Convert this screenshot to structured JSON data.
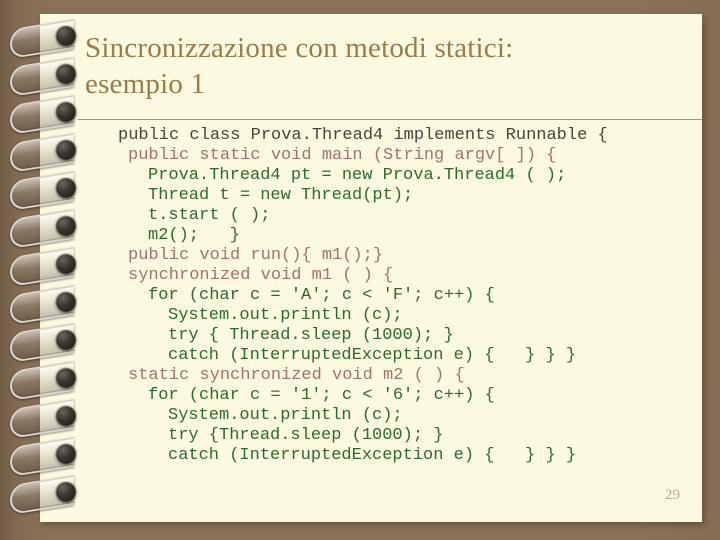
{
  "slide": {
    "title_line_1": "Sincronizzazione con metodi statici:",
    "title_line_2": "esempio 1",
    "page_number": "29",
    "colors": {
      "background": "#8a7258",
      "paper": "#fbfae1",
      "title": "#9c7b4a",
      "rule": "#a89468",
      "code_dark": "#4a453d",
      "code_rose": "#a8706a",
      "code_green": "#2d6b2d",
      "page_number": "#b8a98c"
    }
  },
  "code": {
    "language": "java",
    "lines": [
      {
        "text": "public class Prova.Thread4 implements Runnable {",
        "color": "dark",
        "indent": 0
      },
      {
        "text": "public static void main (String argv[ ]) {",
        "color": "rose",
        "indent": 1
      },
      {
        "text": "Prova.Thread4 pt = new Prova.Thread4 ( );",
        "color": "green",
        "indent": 2
      },
      {
        "text": "Thread t = new Thread(pt);",
        "color": "green",
        "indent": 2
      },
      {
        "text": "t.start ( );",
        "color": "green",
        "indent": 2
      },
      {
        "text": "m2();   }",
        "color": "green",
        "indent": 2
      },
      {
        "text": "public void run(){ m1();}",
        "color": "rose",
        "indent": 1
      },
      {
        "text": "synchronized void m1 ( ) {",
        "color": "rose",
        "indent": 1
      },
      {
        "text": "for (char c = 'A'; c < 'F'; c++) {",
        "color": "green",
        "indent": 2
      },
      {
        "text": "System.out.println (c);",
        "color": "green",
        "indent": 3
      },
      {
        "text": "try { Thread.sleep (1000); }",
        "color": "green",
        "indent": 3
      },
      {
        "text": "catch (InterruptedException e) {   } } }",
        "color": "green",
        "indent": 3
      },
      {
        "text": "static synchronized void m2 ( ) {",
        "color": "rose",
        "indent": 1
      },
      {
        "text": "for (char c = '1'; c < '6'; c++) {",
        "color": "green",
        "indent": 2
      },
      {
        "text": "System.out.println (c);",
        "color": "green",
        "indent": 3
      },
      {
        "text": "try {Thread.sleep (1000); }",
        "color": "green",
        "indent": 3
      },
      {
        "text": "catch (InterruptedException e) {   } } }",
        "color": "green",
        "indent": 3
      }
    ]
  },
  "decor": {
    "spiral_ring_count": 13,
    "spiral_ring_name": "spiral-binding-ring"
  }
}
